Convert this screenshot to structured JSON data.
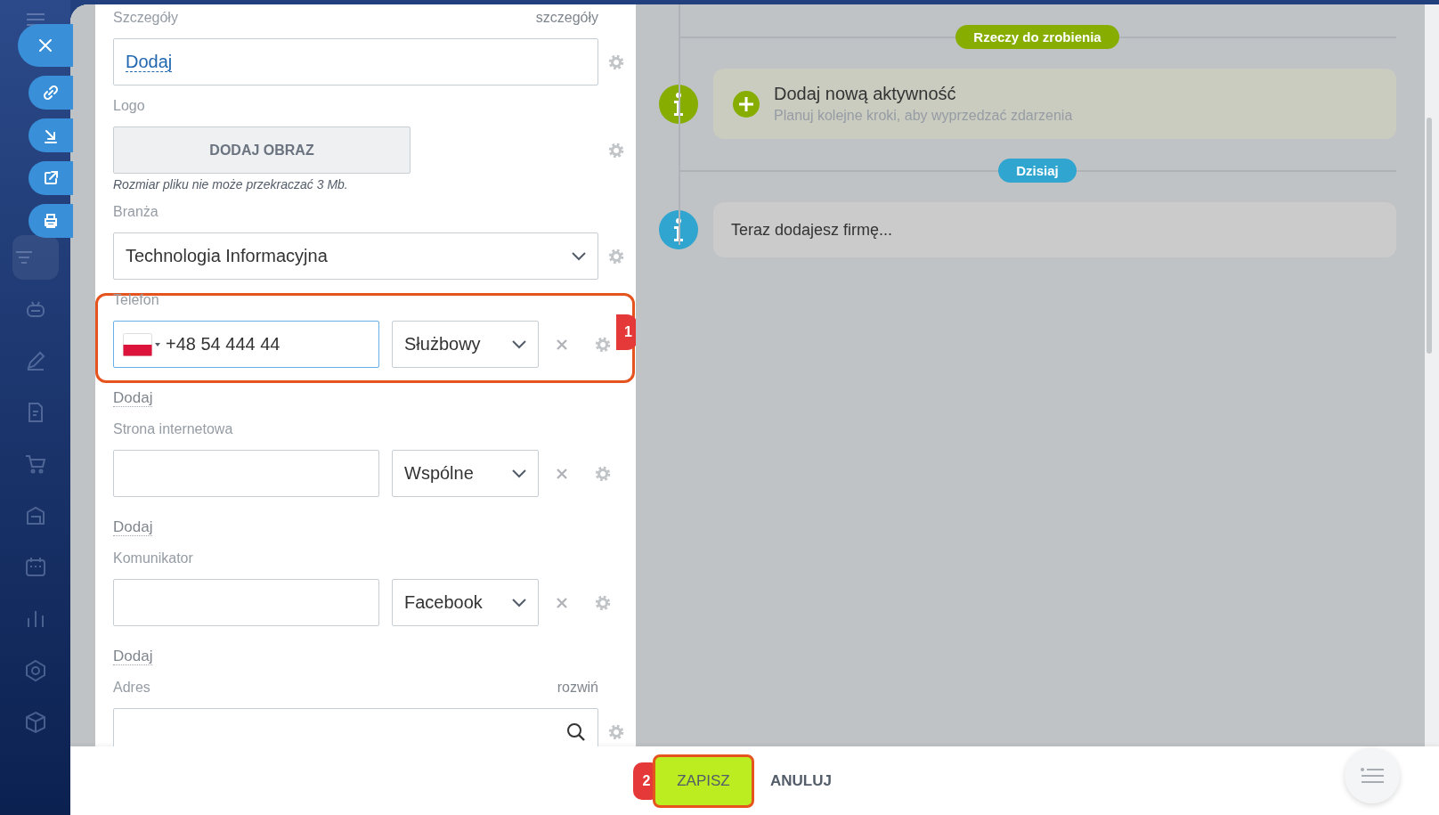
{
  "sidebar": {
    "items": [
      {
        "selected": true
      },
      {
        "selected": false
      },
      {
        "selected": false
      },
      {
        "selected": false
      },
      {
        "selected": false
      },
      {
        "selected": false
      },
      {
        "selected": false
      },
      {
        "selected": false
      },
      {
        "selected": false
      },
      {
        "selected": false
      }
    ]
  },
  "quick_actions": [
    {
      "kind": "close"
    },
    {
      "kind": "link"
    },
    {
      "kind": "download"
    },
    {
      "kind": "open"
    },
    {
      "kind": "print"
    }
  ],
  "form": {
    "fields": [
      {
        "kind": "details",
        "label": "Szczegóły",
        "side_link": "szczegóły",
        "value": "Dodaj"
      },
      {
        "kind": "image",
        "label": "Logo",
        "button": "DODAJ OBRAZ",
        "note": "Rozmiar pliku nie może przekraczać 3 Mb."
      },
      {
        "kind": "select",
        "label": "Branża",
        "value": "Technologia Informacyjna"
      },
      {
        "kind": "multi",
        "label": "Telefon",
        "flag": true,
        "focused": true,
        "value": "+48 54 444 44",
        "type": "Służbowy",
        "callout": "1",
        "add_link": "Dodaj"
      },
      {
        "kind": "multi",
        "label": "Strona internetowa",
        "flag": false,
        "focused": false,
        "type": "Wspólne",
        "add_link": "Dodaj"
      },
      {
        "kind": "multi",
        "label": "Komunikator",
        "flag": false,
        "focused": false,
        "type": "Facebook",
        "add_link": "Dodaj"
      },
      {
        "kind": "address",
        "label": "Adres",
        "side_link": "rozwiń"
      }
    ]
  },
  "timeline": [
    {
      "kind": "divider",
      "label": "Rzeczy do zrobienia",
      "color": "#86ad00"
    },
    {
      "kind": "action",
      "title": "Dodaj nową aktywność",
      "subtitle": "Planuj kolejne kroki, aby wyprzedzać zdarzenia",
      "color": "#86ad00"
    },
    {
      "kind": "divider",
      "label": "Dzisiaj",
      "color": "#2fa5cf"
    },
    {
      "kind": "note",
      "text": "Teraz dodajesz firmę...",
      "color": "#2fa5cf"
    }
  ],
  "footer": {
    "buttons": [
      {
        "kind": "primary",
        "label": "ZAPISZ",
        "callout": "2"
      },
      {
        "kind": "link",
        "label": "ANULUJ"
      }
    ]
  }
}
